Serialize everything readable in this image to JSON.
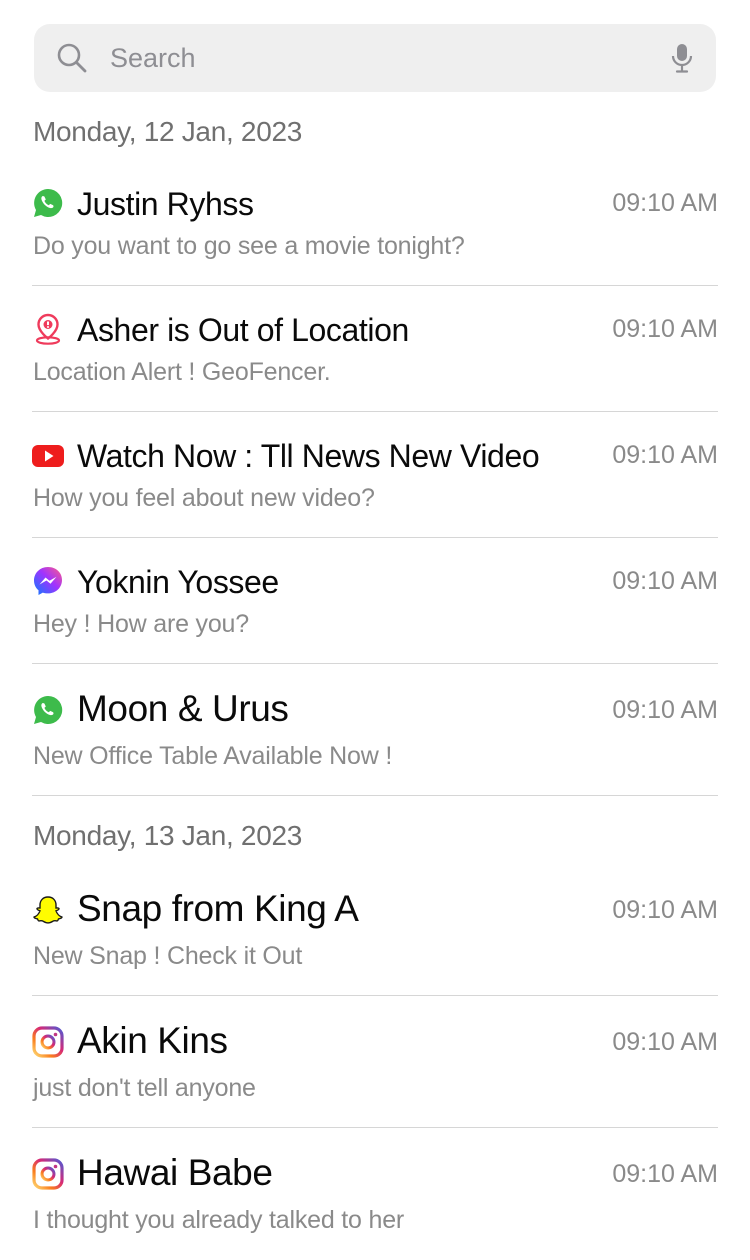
{
  "search": {
    "placeholder": "Search"
  },
  "groups": [
    {
      "date": "Monday, 12 Jan, 2023"
    },
    {
      "date": "Monday, 13 Jan, 2023"
    }
  ],
  "notifications": [
    {
      "app": "whatsapp-icon",
      "title": "Justin Ryhss",
      "message": "Do you want to go see a movie tonight?",
      "time": "09:10 AM"
    },
    {
      "app": "location-pin-icon",
      "title": "Asher is Out of Location",
      "message": "Location Alert ! GeoFencer.",
      "time": "09:10 AM"
    },
    {
      "app": "youtube-icon",
      "title": "Watch Now : Tll News New Video",
      "message": "How you feel about new video?",
      "time": "09:10 AM"
    },
    {
      "app": "messenger-icon",
      "title": "Yoknin Yossee",
      "message": "Hey ! How are you?",
      "time": "09:10 AM"
    },
    {
      "app": "whatsapp-icon",
      "title": "Moon & Urus",
      "message": "New Office Table Available Now !",
      "time": "09:10 AM"
    },
    {
      "app": "snapchat-icon",
      "title": "Snap from King A",
      "message": "New Snap ! Check it Out",
      "time": "09:10 AM"
    },
    {
      "app": "instagram-icon",
      "title": "Akin Kins",
      "message": "just don't tell anyone",
      "time": "09:10 AM"
    },
    {
      "app": "instagram-icon",
      "title": "Hawai Babe",
      "message": "I thought you already talked to her",
      "time": "09:10 AM"
    }
  ],
  "colors": {
    "whatsapp": "#3dbb4b",
    "youtube": "#ee1d1d",
    "location": "#ef3b5c",
    "snapchat": "#fffc00",
    "instagram": "#c13584",
    "messenger": "#7a4cf0"
  }
}
